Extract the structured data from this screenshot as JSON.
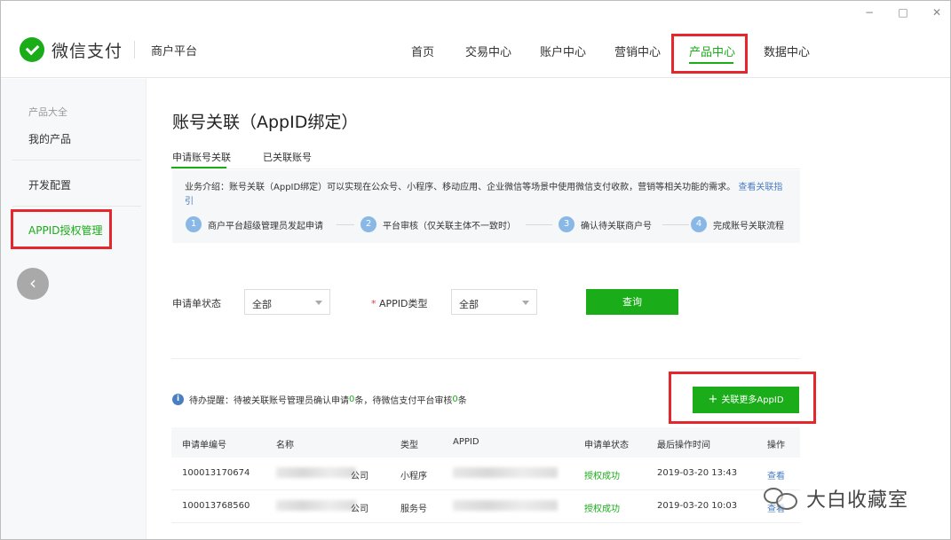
{
  "window": {
    "controls": [
      "−",
      "□",
      "✕"
    ]
  },
  "header": {
    "logo_text": "微信支付",
    "logo_sub": "商户平台",
    "nav": [
      {
        "label": "首页",
        "active": false
      },
      {
        "label": "交易中心",
        "active": false
      },
      {
        "label": "账户中心",
        "active": false
      },
      {
        "label": "营销中心",
        "active": false
      },
      {
        "label": "产品中心",
        "active": true
      },
      {
        "label": "数据中心",
        "active": false
      }
    ]
  },
  "sidebar": {
    "group_title": "产品大全",
    "items": [
      {
        "label": "我的产品"
      },
      {
        "label": "开发配置"
      },
      {
        "label": "APPID授权管理",
        "active": true
      }
    ],
    "collapse_glyph": "‹"
  },
  "main": {
    "title": "账号关联（AppID绑定）",
    "tabs": [
      {
        "label": "申请账号关联",
        "active": true
      },
      {
        "label": "已关联账号",
        "active": false
      }
    ],
    "intro": {
      "text": "业务介绍：账号关联（AppID绑定）可以实现在公众号、小程序、移动应用、企业微信等场景中使用微信支付收款，营销等相关功能的需求。",
      "link": "查看关联指引"
    },
    "steps": [
      {
        "num": "1",
        "label": "商户平台超级管理员发起申请"
      },
      {
        "num": "2",
        "label": "平台审核（仅关联主体不一致时）"
      },
      {
        "num": "3",
        "label": "确认待关联商户号"
      },
      {
        "num": "4",
        "label": "完成账号关联流程"
      }
    ],
    "filters": {
      "status_label": "申请单状态",
      "status_value": "全部",
      "type_required": "*",
      "type_label": "APPID类型",
      "type_value": "全部",
      "query_button": "查询"
    },
    "notice": {
      "icon": "i",
      "prefix": "待办提醒：待被关联账号管理员确认申请",
      "count1": "0",
      "mid": "条，待微信支付平台审核",
      "count2": "0",
      "suffix": "条"
    },
    "add_button": {
      "plus": "+",
      "label": "关联更多AppID"
    },
    "table": {
      "columns": [
        "申请单编号",
        "名称",
        "类型",
        "APPID",
        "申请单状态",
        "最后操作时间",
        "操作"
      ],
      "rows": [
        {
          "id": "100013170674",
          "name_suffix": "公司",
          "type": "小程序",
          "status": "授权成功",
          "time": "2019-03-20 13:43",
          "action": "查看"
        },
        {
          "id": "100013768560",
          "name_suffix": "公司",
          "type": "服务号",
          "status": "授权成功",
          "time": "2019-03-20 10:03",
          "action": "查看"
        }
      ]
    }
  },
  "watermark": {
    "text": "大白收藏室"
  },
  "colors": {
    "brand_green": "#1aad19",
    "link_blue": "#4a7ec2",
    "annotation_red": "#e5272d"
  }
}
